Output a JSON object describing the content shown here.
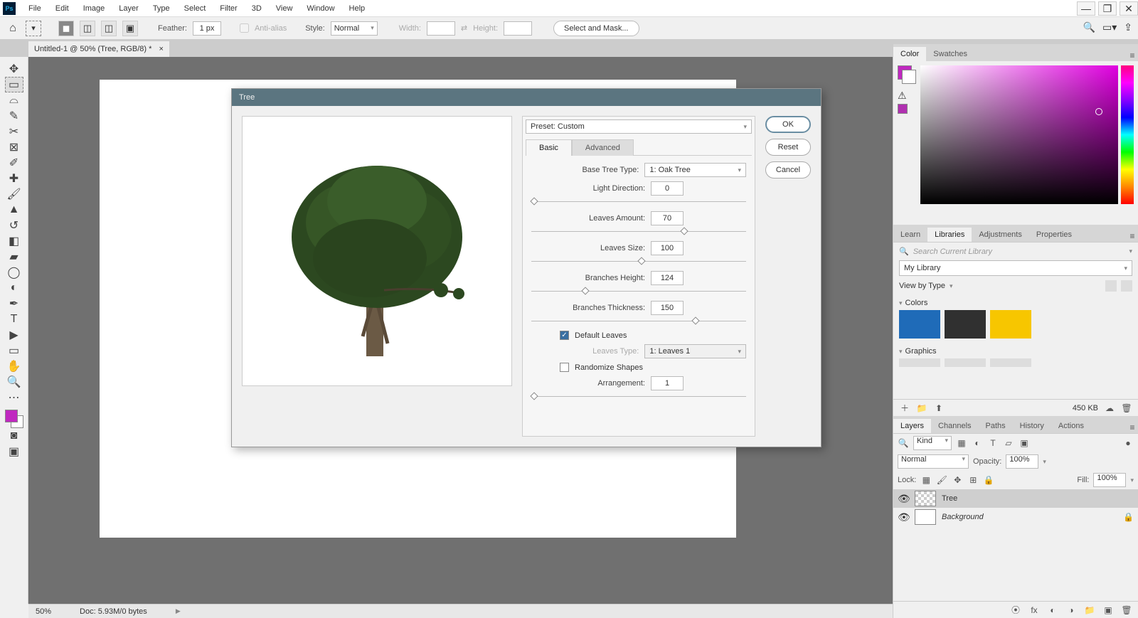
{
  "menu": {
    "items": [
      "File",
      "Edit",
      "Image",
      "Layer",
      "Type",
      "Select",
      "Filter",
      "3D",
      "View",
      "Window",
      "Help"
    ]
  },
  "options": {
    "feather_label": "Feather:",
    "feather_value": "1 px",
    "antialias_label": "Anti-alias",
    "style_label": "Style:",
    "style_value": "Normal",
    "width_label": "Width:",
    "height_label": "Height:",
    "selectmask": "Select and Mask..."
  },
  "doc": {
    "tab": "Untitled-1 @ 50% (Tree, RGB/8) *"
  },
  "panels": {
    "color_tab": "Color",
    "swatches_tab": "Swatches",
    "learn_tab": "Learn",
    "libraries_tab": "Libraries",
    "adjustments_tab": "Adjustments",
    "properties_tab": "Properties",
    "lib_search": "Search Current Library",
    "lib_name": "My Library",
    "viewby": "View by Type",
    "colors_group": "Colors",
    "graphics_group": "Graphics",
    "size": "450 KB",
    "lib_colors": [
      "#1f6bb8",
      "#303030",
      "#f7c600"
    ]
  },
  "layers": {
    "tabs": [
      "Layers",
      "Channels",
      "Paths",
      "History",
      "Actions"
    ],
    "kind": "Kind",
    "blend": "Normal",
    "opacity_label": "Opacity:",
    "opacity": "100%",
    "lock_label": "Lock:",
    "fill_label": "Fill:",
    "fill": "100%",
    "items": [
      {
        "name": "Tree",
        "sel": true,
        "trans": true
      },
      {
        "name": "Background",
        "sel": false,
        "locked": true
      }
    ]
  },
  "status": {
    "zoom": "50%",
    "doc": "Doc: 5.93M/0 bytes"
  },
  "dialog": {
    "title": "Tree",
    "preset_label": "Preset: Custom",
    "tabs": {
      "basic": "Basic",
      "advanced": "Advanced"
    },
    "basetype_label": "Base Tree Type:",
    "basetype_value": "1: Oak Tree",
    "lightdir_label": "Light Direction:",
    "lightdir_value": "0",
    "leavesamt_label": "Leaves Amount:",
    "leavesamt_value": "70",
    "leavessize_label": "Leaves Size:",
    "leavessize_value": "100",
    "branchh_label": "Branches Height:",
    "branchh_value": "124",
    "brancht_label": "Branches Thickness:",
    "brancht_value": "150",
    "defleaves_label": "Default Leaves",
    "leavestype_label": "Leaves Type:",
    "leavestype_value": "1: Leaves 1",
    "randshapes_label": "Randomize Shapes",
    "arrange_label": "Arrangement:",
    "arrange_value": "1",
    "buttons": {
      "ok": "OK",
      "reset": "Reset",
      "cancel": "Cancel"
    }
  }
}
